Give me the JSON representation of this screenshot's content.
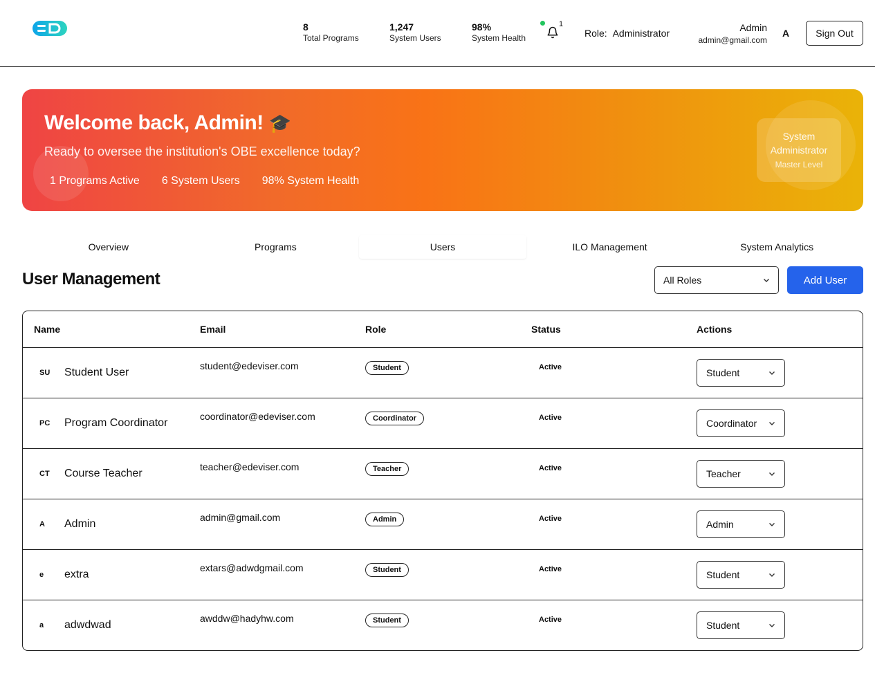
{
  "header": {
    "stats": [
      {
        "value": "8",
        "label": "Total Programs"
      },
      {
        "value": "1,247",
        "label": "System Users"
      },
      {
        "value": "98%",
        "label": "System Health"
      }
    ],
    "notification_count": "1",
    "role_label": "Role:",
    "role_value": "Administrator",
    "user_name": "Admin",
    "user_email": "admin@gmail.com",
    "avatar_initial": "A",
    "sign_out_label": "Sign Out",
    "notification_dot_color": "#22c55e"
  },
  "banner": {
    "welcome": "Welcome back, Admin!",
    "welcome_emoji": "🎓",
    "subtitle": "Ready to oversee the institution's OBE excellence today?",
    "pills": [
      "1 Programs Active",
      "6 System Users",
      "98% System Health"
    ],
    "badge_title": "System Administrator",
    "badge_sub": "Master Level",
    "gradient_colors": [
      "#ef4444",
      "#f97316",
      "#eab308"
    ]
  },
  "tabs": [
    {
      "label": "Overview",
      "active": false
    },
    {
      "label": "Programs",
      "active": false
    },
    {
      "label": "Users",
      "active": true
    },
    {
      "label": "ILO Management",
      "active": false
    },
    {
      "label": "System Analytics",
      "active": false
    }
  ],
  "section": {
    "title": "User Management",
    "filter_value": "All Roles",
    "add_button_label": "Add User",
    "accent_color": "#2563eb"
  },
  "table": {
    "headers": [
      "Name",
      "Email",
      "Role",
      "Status",
      "Actions"
    ],
    "rows": [
      {
        "initials": "SU",
        "name": "Student User",
        "email": "student@edeviser.com",
        "role": "Student",
        "status": "Active",
        "action_role": "Student"
      },
      {
        "initials": "PC",
        "name": "Program Coordinator",
        "email": "coordinator@edeviser.com",
        "role": "Coordinator",
        "status": "Active",
        "action_role": "Coordinator"
      },
      {
        "initials": "CT",
        "name": "Course Teacher",
        "email": "teacher@edeviser.com",
        "role": "Teacher",
        "status": "Active",
        "action_role": "Teacher"
      },
      {
        "initials": "A",
        "name": "Admin",
        "email": "admin@gmail.com",
        "role": "Admin",
        "status": "Active",
        "action_role": "Admin"
      },
      {
        "initials": "e",
        "name": "extra",
        "email": "extars@adwdgmail.com",
        "role": "Student",
        "status": "Active",
        "action_role": "Student"
      },
      {
        "initials": "a",
        "name": "adwdwad",
        "email": "awddw@hadyhw.com",
        "role": "Student",
        "status": "Active",
        "action_role": "Student"
      }
    ]
  }
}
